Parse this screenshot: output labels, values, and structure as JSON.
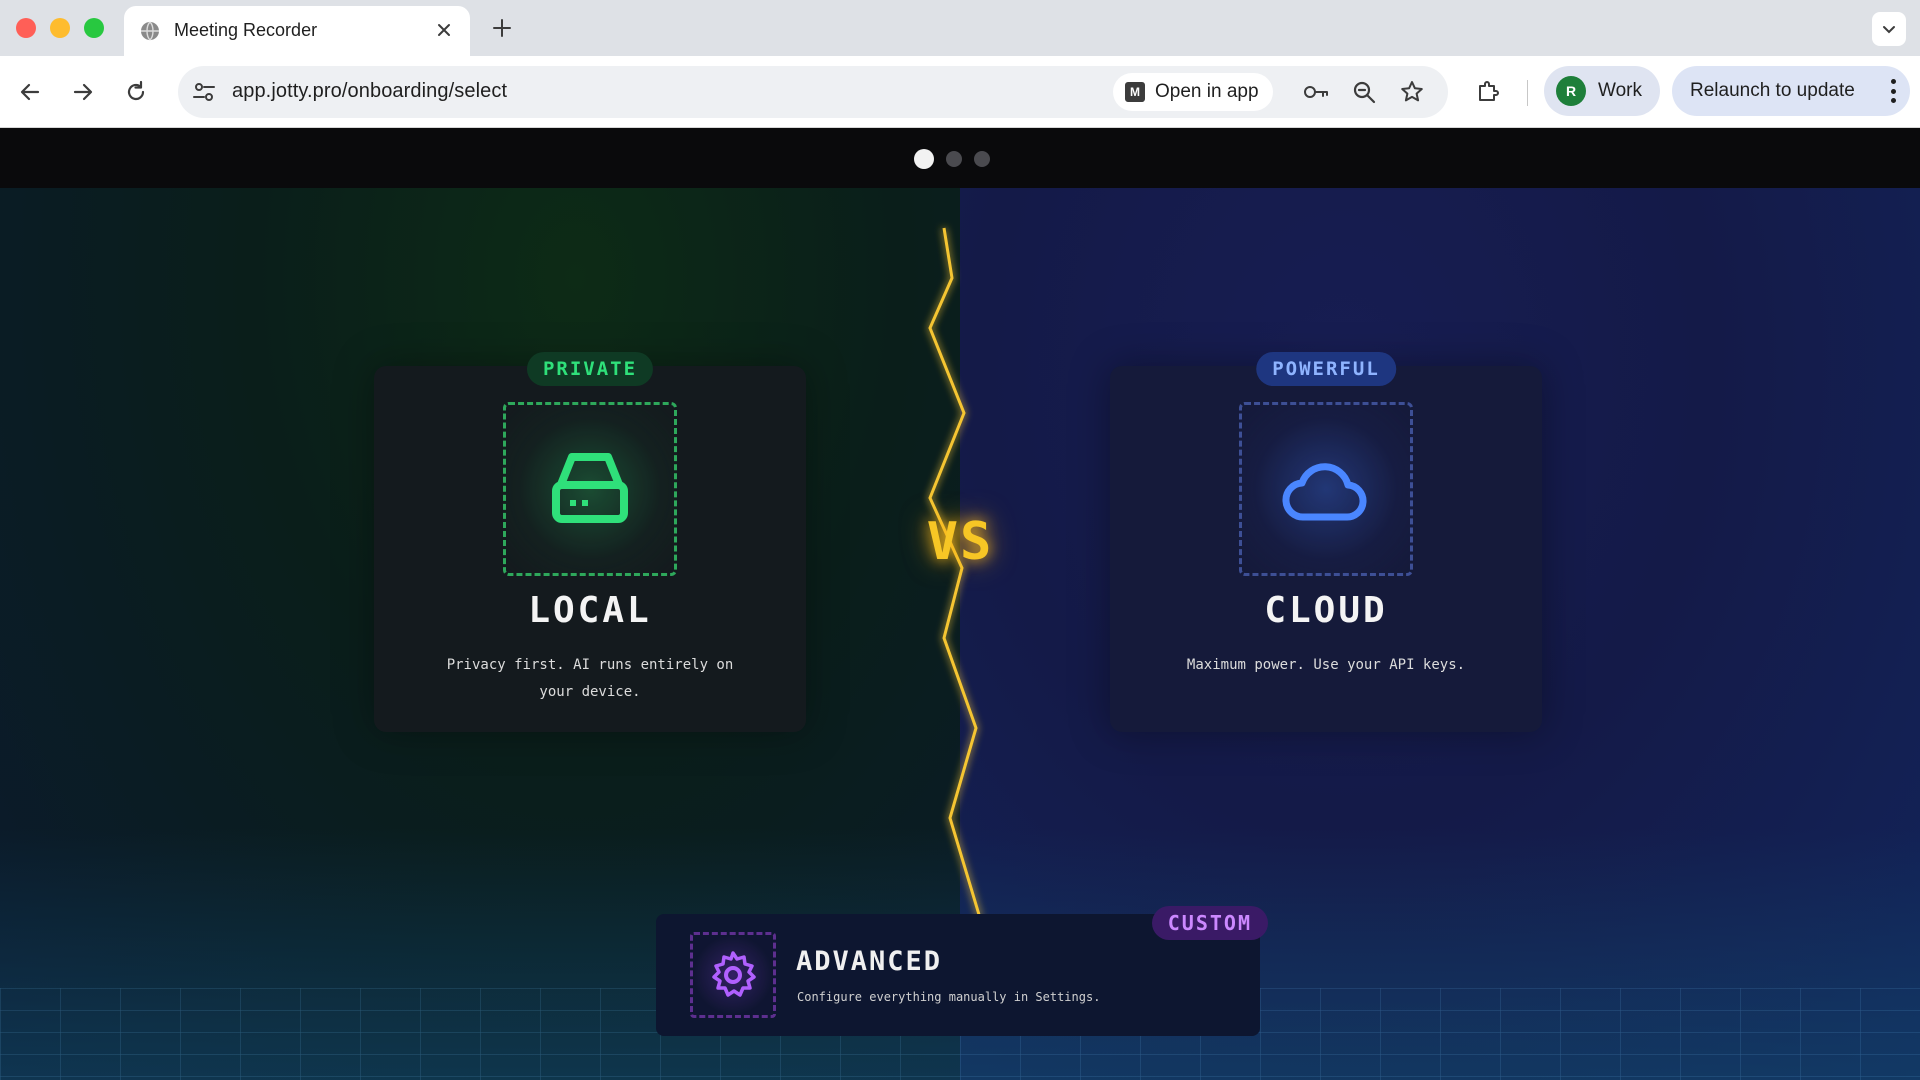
{
  "browser": {
    "tab_title": "Meeting Recorder",
    "url": "app.jotty.pro/onboarding/select",
    "open_in_app_label": "Open in app",
    "profile_initial": "R",
    "profile_name": "Work",
    "relaunch_label": "Relaunch to update"
  },
  "onboarding": {
    "steps_total": 3,
    "active_step": 1,
    "vs_label": "VS",
    "options": {
      "local": {
        "badge": "PRIVATE",
        "title": "LOCAL",
        "description": "Privacy first. AI runs entirely on your device.",
        "icon": "hard-drive-icon",
        "accent": "#2fe07a"
      },
      "cloud": {
        "badge": "POWERFUL",
        "title": "CLOUD",
        "description": "Maximum power. Use your API keys.",
        "icon": "cloud-icon",
        "accent": "#4a86ff"
      },
      "advanced": {
        "badge": "CUSTOM",
        "title": "ADVANCED",
        "description": "Configure everything manually in Settings.",
        "icon": "gear-icon",
        "accent": "#b060ff"
      }
    },
    "lightning_color": "#f5c533"
  }
}
